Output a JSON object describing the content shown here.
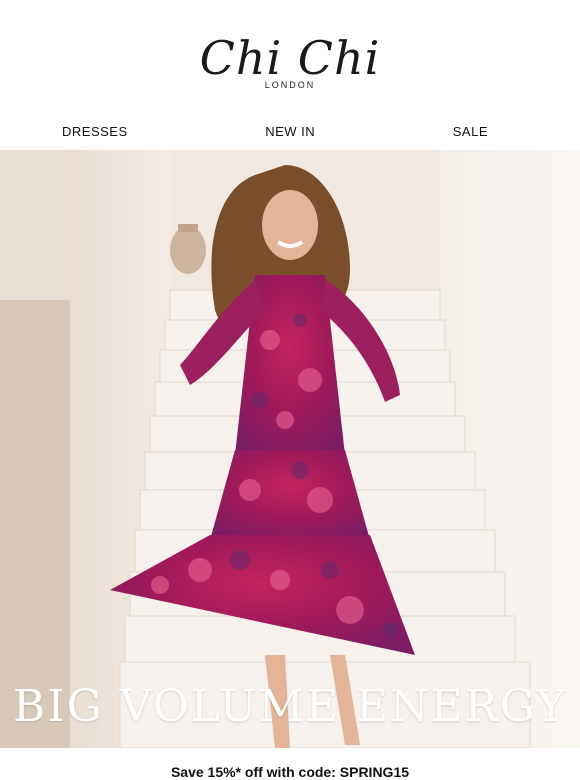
{
  "brand": {
    "name": "Chi Chi",
    "sub": "LONDON"
  },
  "nav": {
    "items": [
      {
        "label": "DRESSES"
      },
      {
        "label": "NEW IN"
      },
      {
        "label": "SALE"
      }
    ]
  },
  "hero": {
    "headline": "BIG VOLUME ENERGY"
  },
  "promo": {
    "text": "Save 15%* off with code: SPRING15"
  }
}
